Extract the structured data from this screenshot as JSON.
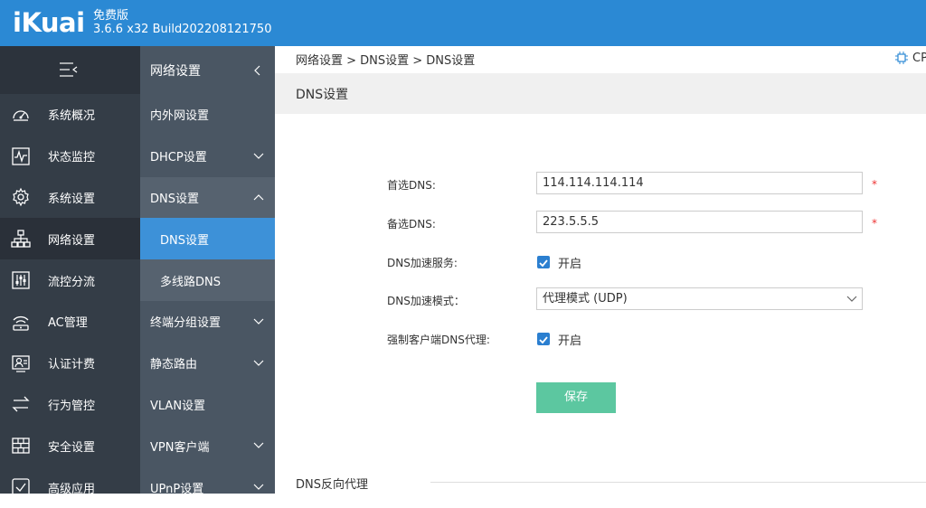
{
  "header": {
    "logo": "iKuai",
    "edition": "免费版",
    "version": "3.6.6 x32 Build202208121750",
    "brand_color": "#2b89d4"
  },
  "sidebar": {
    "menu_toggle_icon": "menu-collapse-icon",
    "items": [
      {
        "label": "系统概况",
        "icon": "dashboard-icon"
      },
      {
        "label": "状态监控",
        "icon": "monitor-pulse-icon"
      },
      {
        "label": "系统设置",
        "icon": "gear-icon"
      },
      {
        "label": "网络设置",
        "icon": "network-topology-icon",
        "active": true
      },
      {
        "label": "流控分流",
        "icon": "sliders-icon"
      },
      {
        "label": "AC管理",
        "icon": "wifi-icon"
      },
      {
        "label": "认证计费",
        "icon": "user-id-icon"
      },
      {
        "label": "行为管控",
        "icon": "swap-arrows-icon"
      },
      {
        "label": "安全设置",
        "icon": "firewall-icon"
      },
      {
        "label": "高级应用",
        "icon": "checkbox-app-icon"
      }
    ]
  },
  "subnav": {
    "title": "网络设置",
    "items": [
      {
        "label": "内外网设置"
      },
      {
        "label": "DHCP设置"
      },
      {
        "label": "DNS设置"
      },
      {
        "label": "DNS设置"
      },
      {
        "label": "多线路DNS"
      },
      {
        "label": "终端分组设置"
      },
      {
        "label": "静态路由"
      },
      {
        "label": "VLAN设置"
      },
      {
        "label": "VPN客户端"
      },
      {
        "label": "UPnP设置"
      }
    ]
  },
  "breadcrumb": "网络设置 > DNS设置 > DNS设置",
  "cpu_label": "CP",
  "page_title": "DNS设置",
  "form": {
    "primary_dns_label": "首选DNS:",
    "primary_dns_value": "114.114.114.114",
    "secondary_dns_label": "备选DNS:",
    "secondary_dns_value": "223.5.5.5",
    "required_mark": "*",
    "accel_service_label": "DNS加速服务:",
    "accel_service_text": "开启",
    "accel_mode_label": "DNS加速模式：",
    "accel_mode_value": "代理模式 (UDP)",
    "force_proxy_label": "强制客户端DNS代理:",
    "force_proxy_text": "开启",
    "save_label": "保存",
    "save_color": "#5cc7a0"
  },
  "section": {
    "reverse_proxy_title": "DNS反向代理"
  }
}
